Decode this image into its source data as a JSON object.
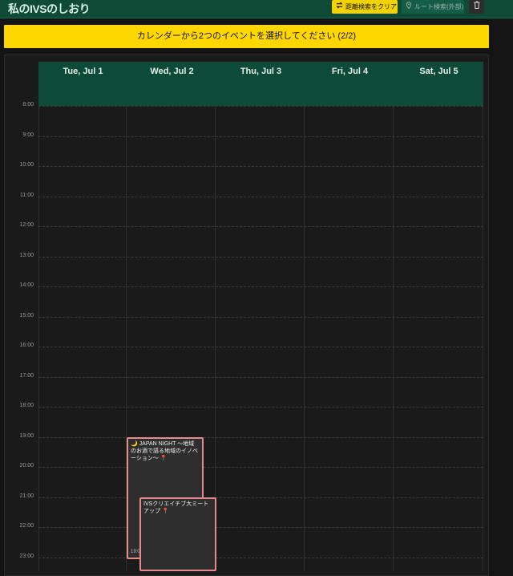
{
  "header": {
    "title": "私のIVSのしおり",
    "clear_label": "距離検索をクリア",
    "route_label": "ルート検索(外部)"
  },
  "banner": {
    "text": "カレンダーから2つのイベントを選択してください (2/2)"
  },
  "calendar": {
    "days": [
      "Tue, Jul 1",
      "Wed, Jul 2",
      "Thu, Jul 3",
      "Fri, Jul 4",
      "Sat, Jul 5"
    ],
    "hours": [
      "8:00",
      "9:00",
      "10:00",
      "11:00",
      "12:00",
      "13:00",
      "14:00",
      "15:00",
      "16:00",
      "17:00",
      "18:00",
      "19:00",
      "20:00",
      "21:00",
      "22:00",
      "23:00"
    ],
    "events": [
      {
        "title": "🌙 JAPAN NIGHT 〜地域のお酒で語る地域のイノベーション〜",
        "pin": "📍",
        "time": "19:0"
      },
      {
        "title": "IVSクリエイチブ大ミートアップ",
        "pin": "📍"
      }
    ]
  },
  "colors": {
    "accent": "#0f4a36",
    "highlight": "#ffd700",
    "event_border": "#e58b8b"
  }
}
